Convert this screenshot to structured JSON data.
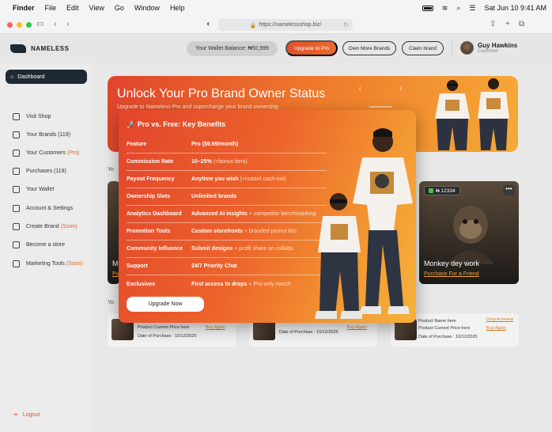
{
  "macbar": {
    "app": "Finder",
    "menus": [
      "File",
      "Edit",
      "View",
      "Go",
      "Window",
      "Help"
    ],
    "datetime": "Sat Jun 10  9:41 AM"
  },
  "browser": {
    "url": "https://namelessshop.biz/"
  },
  "header": {
    "logo": "NAMELESS",
    "wallet": "Your Wallet Balance: ₦50,999",
    "upgrade_btn": "Upgrade to Pro",
    "own_more_btn": "Own More Brands",
    "claim_btn": "Claim brand",
    "user_name": "Guy Hawkins",
    "user_role": "Customer"
  },
  "sidebar": {
    "dashboard": "Dashboard",
    "items": [
      {
        "label": "Visit Shop",
        "extra": ""
      },
      {
        "label": "Your Brands (119)",
        "extra": ""
      },
      {
        "label": "Your Customers ",
        "extra": "(Pro)"
      },
      {
        "label": "Purchases (119)",
        "extra": ""
      },
      {
        "label": "Your Wallet",
        "extra": ""
      },
      {
        "label": "Account & Settings",
        "extra": ""
      },
      {
        "label": "Create Brand ",
        "extra": "(Soon)"
      },
      {
        "label": "Become a store",
        "extra": ""
      },
      {
        "label": "Marketing Tools ",
        "extra": "(Soon)"
      }
    ],
    "logout": "Logout"
  },
  "hero": {
    "title": "Unlock Your Pro Brand Owner Status",
    "subtitle": "Upgrade to Nameless Pro and supercharge your brand ownership"
  },
  "section_labels": {
    "yours": "Yo",
    "yours2": "Yo"
  },
  "nft_cards": [
    {
      "badge": "",
      "title": "M",
      "link": "Pu"
    },
    {
      "badge": "₦ 12334",
      "title": "Monkey dey work",
      "link": "Purchase For a Friend"
    }
  ],
  "purchases": [
    {
      "line1": "Product Current Price here",
      "line2": "Date of Purchase : 10/12/2025",
      "link": "Buy Again"
    },
    {
      "line1": "",
      "line2": "Date of Purchase : 10/12/2025",
      "link": "Buy Again"
    },
    {
      "line0": "Product Name here",
      "line1": "Product Current Price here",
      "line2": "Date of Purchase : 10/12/2025",
      "link": "Buy Again",
      "link0": "Drop A review"
    }
  ],
  "benefits": {
    "title": "🚀 Pro vs. Free: Key Benefits",
    "rows": [
      {
        "k": "Feature",
        "v": "Pro ($9.99/month)",
        "extra": ""
      },
      {
        "k": "Commission Rate",
        "v": "10–25%",
        "extra": " (+bonus tiers)"
      },
      {
        "k": "Payout Frequency",
        "v": "Anytime you wish",
        "extra": " (+instant cash-out)"
      },
      {
        "k": "Ownership Slots",
        "v": "Unlimited brands",
        "extra": ""
      },
      {
        "k": "Analytics Dashboard",
        "v": "Advanced AI insights",
        "extra": " + competitor benchmarking"
      },
      {
        "k": "Promotion Tools",
        "v": "Custom storefronts",
        "extra": " + branded promo kits"
      },
      {
        "k": "Community Influence",
        "v": "Submit designs",
        "extra": " + profit share on collabs"
      },
      {
        "k": "Support",
        "v": "24/7 Priority Chat",
        "extra": ""
      },
      {
        "k": "Exclusives",
        "v": "First access to drops",
        "extra": " + Pro-only merch"
      }
    ],
    "cta": "Upgrade Now"
  },
  "colors": {
    "accent": "#e2502d",
    "accent_end": "#f6b23a",
    "nav_dark": "#1e2a33"
  }
}
